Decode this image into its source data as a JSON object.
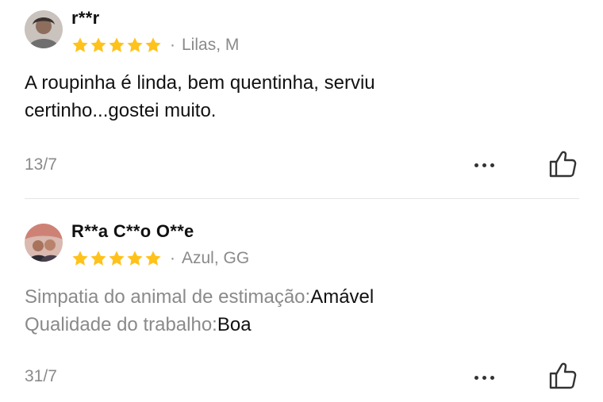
{
  "colors": {
    "star": "#FFC21A",
    "muted_text": "#8a8a8a",
    "primary_text": "#111111",
    "divider": "#e5e5e5"
  },
  "reviews": [
    {
      "username": "r**r",
      "rating": 5,
      "separator": "·",
      "variant": "Lilas, M",
      "text": "A roupinha é linda, bem quentinha, serviu certinho...gostei muito.",
      "date": "13/7",
      "more_icon": "more-horizontal-icon",
      "like_icon": "thumbs-up-icon"
    },
    {
      "username": "R**a C**o O**e",
      "rating": 5,
      "separator": "·",
      "variant": "Azul, GG",
      "attributes": [
        {
          "label": "Simpatia do animal de estimação:",
          "value": "Amável"
        },
        {
          "label": "Qualidade do trabalho:",
          "value": "Boa"
        }
      ],
      "date": "31/7",
      "more_icon": "more-horizontal-icon",
      "like_icon": "thumbs-up-icon"
    }
  ]
}
